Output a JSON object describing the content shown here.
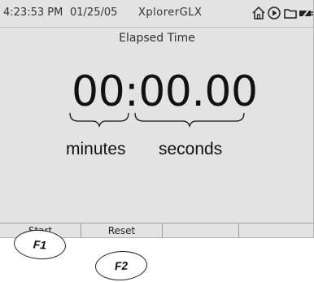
{
  "status_bar": {
    "time": "4:23:53 PM",
    "date": "01/25/05",
    "app_name": "XplorerGLX",
    "icons": [
      "home-icon",
      "play-icon",
      "folder-icon",
      "battery-plug-icon"
    ]
  },
  "main": {
    "title": "Elapsed Time",
    "elapsed_value": "00:00.00",
    "minutes_label": "minutes",
    "seconds_label": "seconds"
  },
  "softkeys": [
    {
      "label": "Start"
    },
    {
      "label": "Reset"
    },
    {
      "label": ""
    },
    {
      "label": ""
    }
  ],
  "function_keys": [
    {
      "label": "F1"
    },
    {
      "label": "F2"
    }
  ],
  "colors": {
    "screen_background": "#e2e3e2",
    "text": "#111111",
    "divider": "#9e9e9e"
  }
}
